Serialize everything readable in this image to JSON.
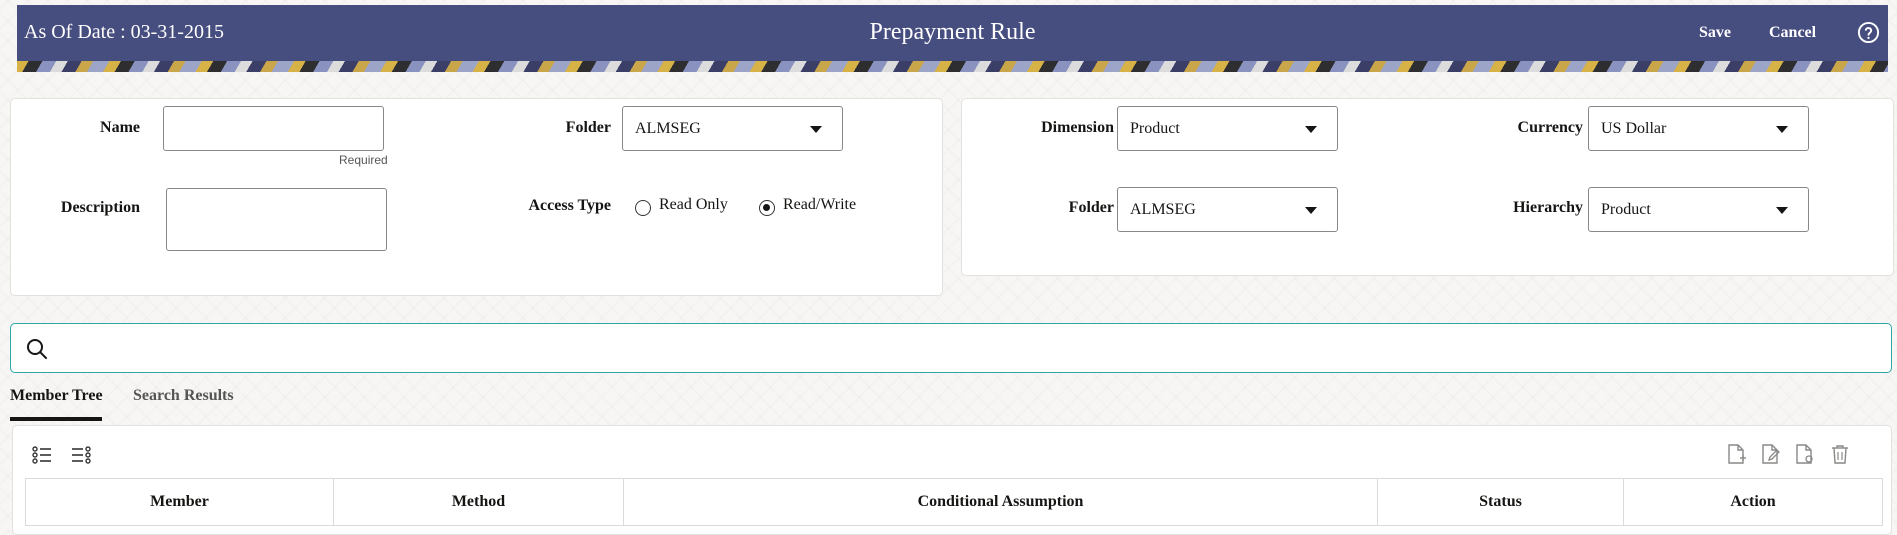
{
  "header": {
    "as_of": "As Of Date : 03-31-2015",
    "title": "Prepayment Rule",
    "save_label": "Save",
    "cancel_label": "Cancel",
    "help_icon": "help-circle-icon",
    "bg_color": "#464d7f"
  },
  "form_left": {
    "name_label": "Name",
    "name_value": "",
    "required_hint": "Required",
    "description_label": "Description",
    "description_value": "",
    "folder_label": "Folder",
    "folder_value": "ALMSEG",
    "access_type_label": "Access Type",
    "access_options": [
      "Read Only",
      "Read/Write"
    ],
    "access_selected": "Read/Write"
  },
  "form_right": {
    "dimension_label": "Dimension",
    "dimension_value": "Product",
    "folder_label": "Folder",
    "folder_value": "ALMSEG",
    "currency_label": "Currency",
    "currency_value": "US Dollar",
    "hierarchy_label": "Hierarchy",
    "hierarchy_value": "Product"
  },
  "search": {
    "placeholder": "",
    "border_color": "#2da8a4"
  },
  "tabs": [
    {
      "label": "Member Tree",
      "active": true
    },
    {
      "label": "Search Results",
      "active": false
    }
  ],
  "toolbar": {
    "left_icons": [
      "expand-all-icon",
      "collapse-all-icon"
    ],
    "right_icons": [
      "add-document-icon",
      "edit-document-icon",
      "view-document-icon",
      "delete-icon"
    ]
  },
  "table": {
    "columns": [
      "Member",
      "Method",
      "Conditional Assumption",
      "Status",
      "Action"
    ]
  }
}
